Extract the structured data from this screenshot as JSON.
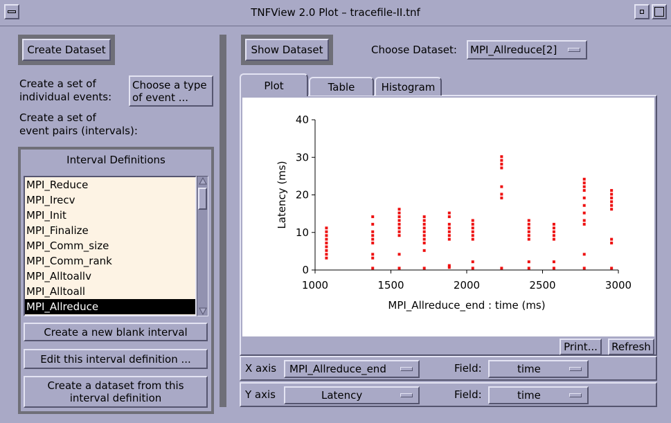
{
  "window": {
    "title": "TNFView 2.0 Plot – tracefile-II.tnf"
  },
  "left": {
    "create_dataset_label": "Create Dataset",
    "individual_events_label_1": "Create a set of",
    "individual_events_label_2": "individual events:",
    "choose_type_line1": "Choose a type",
    "choose_type_line2": "of event ...",
    "event_pairs_label_1": "Create a set of",
    "event_pairs_label_2": "event pairs (intervals):",
    "interval_definitions_title": "Interval Definitions",
    "intervals": [
      "MPI_Reduce",
      "MPI_Irecv",
      "MPI_Init",
      "MPI_Finalize",
      "MPI_Comm_size",
      "MPI_Comm_rank",
      "MPI_Alltoallv",
      "MPI_Alltoall",
      "MPI_Allreduce"
    ],
    "selected_interval": "MPI_Allreduce",
    "new_blank_interval_label": "Create a new blank interval",
    "edit_interval_label": "Edit this interval definition ...",
    "create_dataset_from_line1": "Create a dataset from this",
    "create_dataset_from_line2": "interval definition"
  },
  "right": {
    "show_dataset_label": "Show Dataset",
    "choose_dataset_label": "Choose Dataset:",
    "chosen_dataset": "MPI_Allreduce[2]",
    "tabs": [
      "Plot",
      "Table",
      "Histogram"
    ],
    "active_tab": "Plot",
    "print_label": "Print...",
    "refresh_label": "Refresh",
    "x_axis_label": "X axis",
    "x_axis_value": "MPI_Allreduce_end",
    "x_field_label": "Field:",
    "x_field_value": "time",
    "y_axis_label": "Y axis",
    "y_axis_value": "Latency",
    "y_field_label": "Field:",
    "y_field_value": "time"
  },
  "colors": {
    "point": "#ee1111",
    "background": "#a9a9c6"
  },
  "chart_data": {
    "type": "scatter",
    "xlabel": "MPI_Allreduce_end : time (ms)",
    "ylabel": "Latency (ms)",
    "xlim": [
      1000,
      3000
    ],
    "ylim": [
      0,
      40
    ],
    "xticks": [
      1000,
      1500,
      2000,
      2500,
      3000
    ],
    "yticks": [
      0,
      10,
      20,
      30,
      40
    ],
    "grid": false,
    "series": [
      {
        "points": [
          [
            1075,
            3
          ],
          [
            1075,
            4
          ],
          [
            1075,
            5
          ],
          [
            1075,
            6
          ],
          [
            1075,
            7
          ],
          [
            1075,
            8
          ],
          [
            1075,
            9
          ],
          [
            1075,
            10
          ],
          [
            1075,
            11
          ],
          [
            1380,
            0.3
          ],
          [
            1380,
            3
          ],
          [
            1380,
            4
          ],
          [
            1380,
            7
          ],
          [
            1380,
            8
          ],
          [
            1380,
            9
          ],
          [
            1380,
            10
          ],
          [
            1380,
            12
          ],
          [
            1380,
            14
          ],
          [
            1555,
            0.3
          ],
          [
            1555,
            4
          ],
          [
            1555,
            9
          ],
          [
            1555,
            10
          ],
          [
            1555,
            11
          ],
          [
            1555,
            12
          ],
          [
            1555,
            13
          ],
          [
            1555,
            14
          ],
          [
            1555,
            15
          ],
          [
            1555,
            16
          ],
          [
            1720,
            0.3
          ],
          [
            1720,
            5
          ],
          [
            1720,
            7
          ],
          [
            1720,
            8
          ],
          [
            1720,
            9
          ],
          [
            1720,
            10
          ],
          [
            1720,
            11
          ],
          [
            1720,
            12
          ],
          [
            1720,
            13
          ],
          [
            1720,
            14
          ],
          [
            1885,
            0.5
          ],
          [
            1885,
            1
          ],
          [
            1885,
            8
          ],
          [
            1885,
            9
          ],
          [
            1885,
            10
          ],
          [
            1885,
            11
          ],
          [
            1885,
            12
          ],
          [
            1885,
            14
          ],
          [
            1885,
            15
          ],
          [
            2040,
            0.3
          ],
          [
            2040,
            2
          ],
          [
            2040,
            8
          ],
          [
            2040,
            9
          ],
          [
            2040,
            10
          ],
          [
            2040,
            11
          ],
          [
            2040,
            12
          ],
          [
            2040,
            13
          ],
          [
            2230,
            0.3
          ],
          [
            2230,
            19
          ],
          [
            2230,
            20
          ],
          [
            2230,
            22
          ],
          [
            2230,
            27
          ],
          [
            2230,
            28
          ],
          [
            2230,
            29
          ],
          [
            2230,
            30
          ],
          [
            2410,
            0.3
          ],
          [
            2410,
            2
          ],
          [
            2410,
            8
          ],
          [
            2410,
            9
          ],
          [
            2410,
            10
          ],
          [
            2410,
            11
          ],
          [
            2410,
            12
          ],
          [
            2410,
            13
          ],
          [
            2575,
            0.3
          ],
          [
            2575,
            2
          ],
          [
            2575,
            8
          ],
          [
            2575,
            9
          ],
          [
            2575,
            10
          ],
          [
            2575,
            11
          ],
          [
            2575,
            12
          ],
          [
            2775,
            0.3
          ],
          [
            2775,
            4
          ],
          [
            2775,
            12
          ],
          [
            2775,
            13
          ],
          [
            2775,
            15
          ],
          [
            2775,
            17
          ],
          [
            2775,
            19
          ],
          [
            2775,
            21
          ],
          [
            2775,
            22
          ],
          [
            2775,
            23
          ],
          [
            2775,
            24
          ],
          [
            2955,
            0.3
          ],
          [
            2955,
            7
          ],
          [
            2955,
            8
          ],
          [
            2955,
            16
          ],
          [
            2955,
            17
          ],
          [
            2955,
            18
          ],
          [
            2955,
            19
          ],
          [
            2955,
            20
          ],
          [
            2955,
            21
          ]
        ]
      }
    ]
  }
}
